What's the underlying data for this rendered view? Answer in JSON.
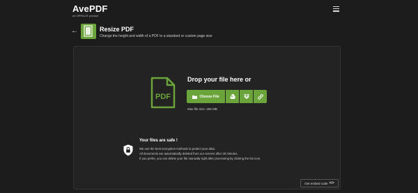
{
  "header": {
    "logo": "AvePDF",
    "logo_sub": "an ORPALIS product"
  },
  "tool": {
    "title": "Resize PDF",
    "description": "Change the height and width of a PDF to a standard or custom page size"
  },
  "upload": {
    "drop_title": "Drop your file here or",
    "choose_label": "Choose File",
    "max_size": "Max file size: 256 MB",
    "icon_text": "PDF"
  },
  "security": {
    "title": "Your files are safe !",
    "lines": [
      "We use the best encryption methods to protect your data.",
      "All documents are automatically deleted from our servers after 30 minutes.",
      "If you prefer, you can delete your file manually right after processing by clicking the bin icon."
    ]
  },
  "embed": {
    "label": "Get embed code"
  },
  "colors": {
    "accent": "#6ba43a",
    "background": "#1c1c1c",
    "panel": "#232323"
  }
}
